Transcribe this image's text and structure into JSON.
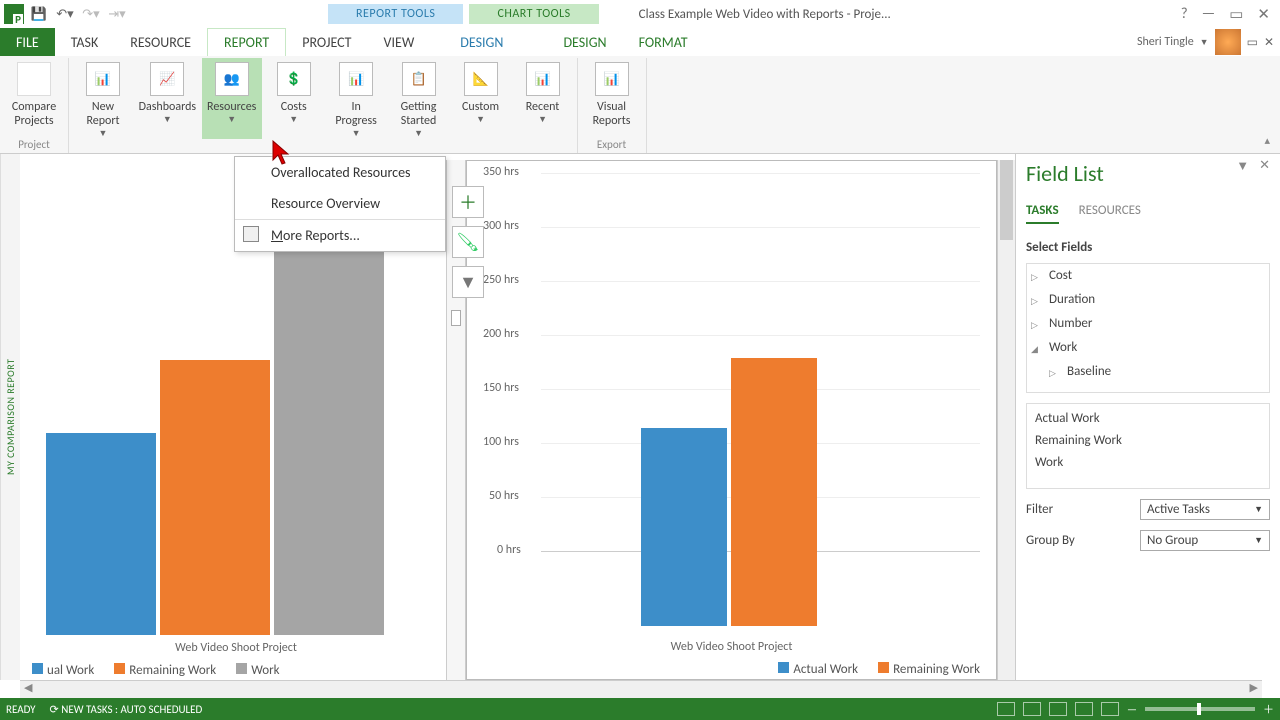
{
  "titlebar": {
    "context_report": "REPORT TOOLS",
    "context_chart": "CHART TOOLS",
    "document": "Class Example Web Video with Reports - Proje..."
  },
  "tabs": {
    "file": "FILE",
    "task": "TASK",
    "resource": "RESOURCE",
    "report": "REPORT",
    "project": "PROJECT",
    "view": "VIEW",
    "design1": "DESIGN",
    "design2": "DESIGN",
    "format": "FORMAT"
  },
  "user": {
    "name": "Sheri Tingle"
  },
  "ribbon": {
    "group_project": "Project",
    "compare": "Compare\nProjects",
    "new_report": "New\nReport",
    "dashboards": "Dashboards",
    "resources": "Resources",
    "costs": "Costs",
    "in_progress": "In Progress",
    "getting_started": "Getting\nStarted",
    "custom": "Custom",
    "recent": "Recent",
    "visual_reports": "Visual\nReports",
    "group_export": "Export"
  },
  "menu": {
    "item1": "Overallocated Resources",
    "item2": "Resource Overview",
    "item3": "More Reports..."
  },
  "side_label": "MY COMPARISON REPORT",
  "chart_left": {
    "xcat": "Web Video Shoot Project",
    "legend": {
      "a": "ual Work",
      "b": "Remaining Work",
      "c": "Work"
    }
  },
  "chart_right": {
    "ylabels": [
      "350 hrs",
      "300 hrs",
      "250 hrs",
      "200 hrs",
      "150 hrs",
      "100 hrs",
      "50 hrs",
      "0 hrs"
    ],
    "xcat": "Web Video Shoot Project",
    "legend": {
      "a": "Actual Work",
      "b": "Remaining Work"
    }
  },
  "chart_data": [
    {
      "type": "bar",
      "categories": [
        "Web Video Shoot Project"
      ],
      "series": [
        {
          "name": "Actual Work",
          "values": [
            225
          ]
        },
        {
          "name": "Remaining Work",
          "values": [
            275
          ]
        },
        {
          "name": "Work",
          "values": [
            500
          ]
        }
      ],
      "ylabel": "hrs"
    },
    {
      "type": "bar",
      "categories": [
        "Web Video Shoot Project"
      ],
      "series": [
        {
          "name": "Actual Work",
          "values": [
            183
          ]
        },
        {
          "name": "Remaining Work",
          "values": [
            248
          ]
        }
      ],
      "ylabel": "hrs",
      "ylim": [
        0,
        350
      ]
    }
  ],
  "pane": {
    "title": "Field List",
    "tab_tasks": "TASKS",
    "tab_resources": "RESOURCES",
    "select_fields": "Select Fields",
    "tree": {
      "cost": "Cost",
      "duration": "Duration",
      "number": "Number",
      "work": "Work",
      "baseline": "Baseline"
    },
    "list": {
      "a": "Actual Work",
      "b": "Remaining Work",
      "c": "Work"
    },
    "filter_lbl": "Filter",
    "filter_val": "Active Tasks",
    "group_lbl": "Group By",
    "group_val": "No Group"
  },
  "status": {
    "ready": "READY",
    "sched": "NEW TASKS : AUTO SCHEDULED"
  }
}
